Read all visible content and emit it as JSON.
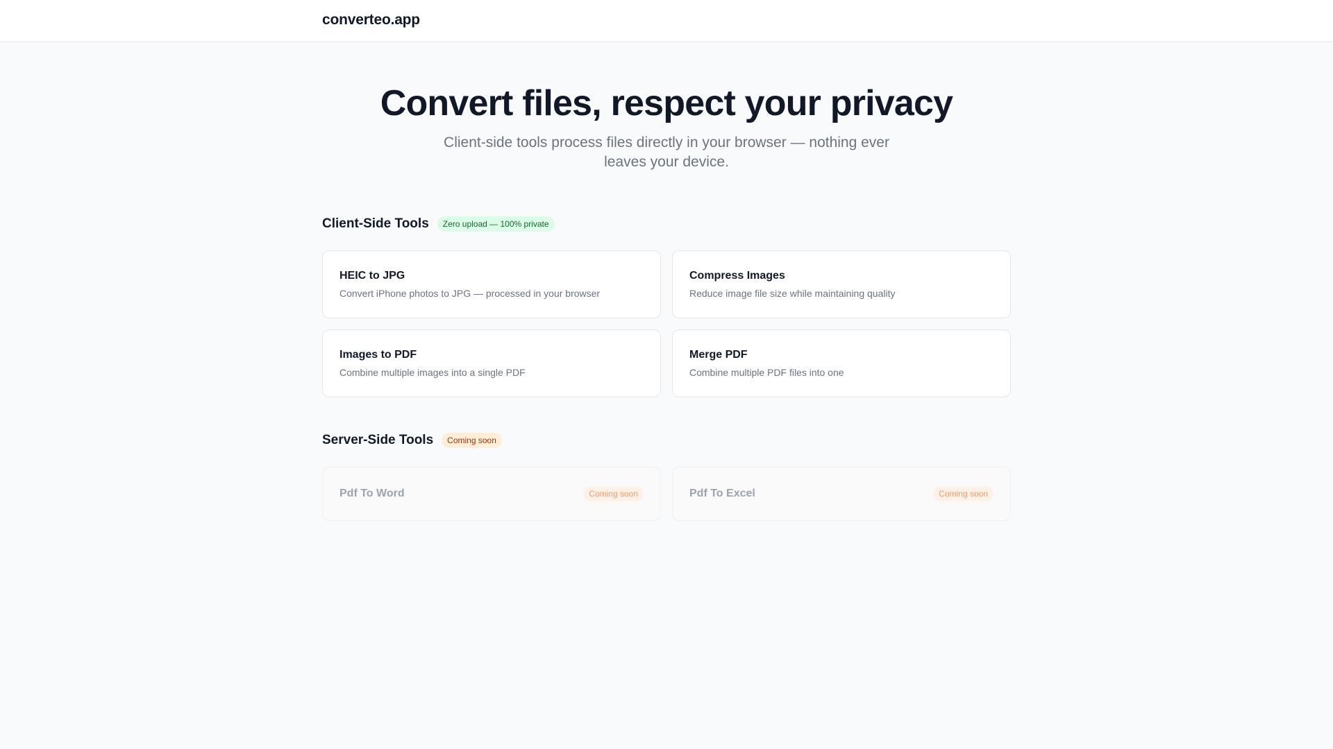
{
  "header": {
    "brand": "converteo.app"
  },
  "hero": {
    "title": "Convert files, respect your privacy",
    "subtitle": "Client-side tools process files directly in your browser — nothing ever leaves your device."
  },
  "client_section": {
    "title": "Client-Side Tools",
    "badge": "Zero upload — 100% private",
    "tools": [
      {
        "title": "HEIC to JPG",
        "description": "Convert iPhone photos to JPG — processed in your browser"
      },
      {
        "title": "Compress Images",
        "description": "Reduce image file size while maintaining quality"
      },
      {
        "title": "Images to PDF",
        "description": "Combine multiple images into a single PDF"
      },
      {
        "title": "Merge PDF",
        "description": "Combine multiple PDF files into one"
      }
    ]
  },
  "server_section": {
    "title": "Server-Side Tools",
    "badge": "Coming soon",
    "tools": [
      {
        "title": "Pdf To Word",
        "badge": "Coming soon"
      },
      {
        "title": "Pdf To Excel",
        "badge": "Coming soon"
      }
    ]
  },
  "colors": {
    "background": "#f9fafb",
    "card": "#ffffff",
    "text_primary": "#111827",
    "text_secondary": "#6b7280",
    "badge_green_bg": "#dcfce7",
    "badge_green_text": "#166534",
    "badge_orange_bg": "#ffedd5",
    "badge_orange_text": "#9a3412"
  }
}
